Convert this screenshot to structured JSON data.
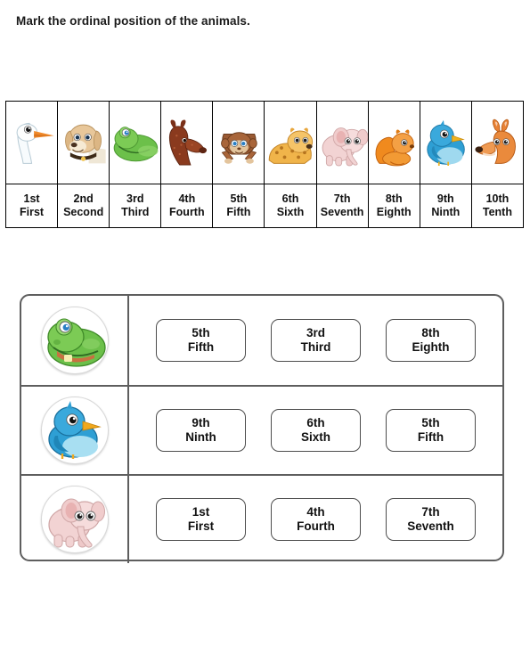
{
  "worksheet": {
    "title": "Mark the ordinal position of the animals."
  },
  "ordinal_table": {
    "cells": [
      {
        "num": "1st",
        "word": "First",
        "animal": "goose"
      },
      {
        "num": "2nd",
        "word": "Second",
        "animal": "dog"
      },
      {
        "num": "3rd",
        "word": "Third",
        "animal": "frog"
      },
      {
        "num": "4th",
        "word": "Fourth",
        "animal": "deer"
      },
      {
        "num": "5th",
        "word": "Fifth",
        "animal": "monkey"
      },
      {
        "num": "6th",
        "word": "Sixth",
        "animal": "leopard"
      },
      {
        "num": "7th",
        "word": "Seventh",
        "animal": "elephant"
      },
      {
        "num": "8th",
        "word": "Eighth",
        "animal": "squirrel"
      },
      {
        "num": "9th",
        "word": "Ninth",
        "animal": "bird"
      },
      {
        "num": "10th",
        "word": "Tenth",
        "animal": "kangaroo"
      }
    ]
  },
  "answer_table": {
    "rows": [
      {
        "animal": "frog",
        "options": [
          {
            "num": "5th",
            "word": "Fifth"
          },
          {
            "num": "3rd",
            "word": "Third"
          },
          {
            "num": "8th",
            "word": "Eighth"
          }
        ]
      },
      {
        "animal": "bird",
        "options": [
          {
            "num": "9th",
            "word": "Ninth"
          },
          {
            "num": "6th",
            "word": "Sixth"
          },
          {
            "num": "5th",
            "word": "Fifth"
          }
        ]
      },
      {
        "animal": "elephant",
        "options": [
          {
            "num": "1st",
            "word": "First"
          },
          {
            "num": "4th",
            "word": "Fourth"
          },
          {
            "num": "7th",
            "word": "Seventh"
          }
        ]
      }
    ]
  },
  "colors": {
    "table_border": "#000000",
    "answer_border": "#5e5e5e",
    "option_border": "#4d4d4d",
    "text": "#111111",
    "goose_body": "#f4f8fa",
    "goose_beak": "#f08a2b",
    "dog_body": "#e8c79a",
    "frog_body": "#6cc04a",
    "deer_body": "#8a3a1e",
    "monkey_body": "#9a5a33",
    "leopard_body": "#f0b44a",
    "elephant_body": "#f2d3d3",
    "squirrel_body": "#f08a1e",
    "bird_body": "#2e9fd4",
    "kangaroo_body": "#e88236"
  }
}
